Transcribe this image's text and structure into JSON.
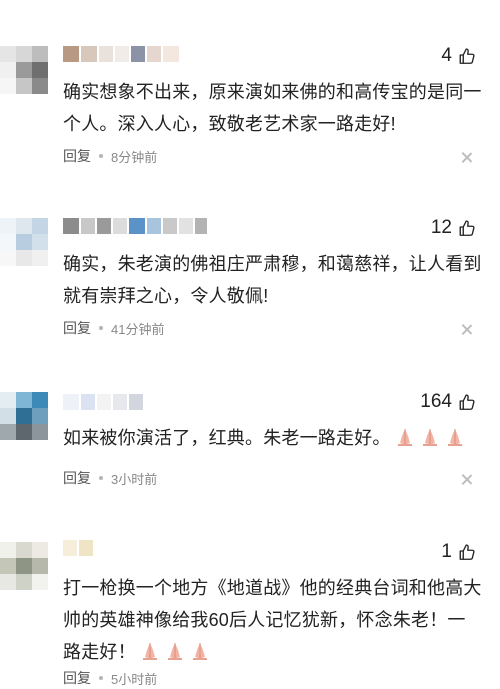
{
  "comments": [
    {
      "likes": "4",
      "text": "确实想象不出来，原来演如来佛的和高传宝的是同一个人。深入人心，致敬老艺术家一路走好!",
      "reply_label": "回复",
      "time": "8分钟前",
      "emoji_count": 0
    },
    {
      "likes": "12",
      "text": "确实，朱老演的佛祖庄严肃穆，和蔼慈祥，让人看到就有崇拜之心，令人敬佩!",
      "reply_label": "回复",
      "time": "41分钟前",
      "emoji_count": 0
    },
    {
      "likes": "164",
      "text": "如来被你演活了，红典。朱老一路走好。",
      "reply_label": "回复",
      "time": "3小时前",
      "emoji_count": 3
    },
    {
      "likes": "1",
      "text": "打一枪换一个地方《地道战》他的经典台词和他高大帅的英雄神像给我60后人记忆犹新，怀念朱老！一路走好！",
      "reply_label": "回复",
      "time": "5小时前",
      "emoji_count": 3
    }
  ],
  "icons": {
    "like": "thumbs-up-icon",
    "close": "close-icon",
    "emoji": "praying-hands-emoji"
  },
  "colors": {
    "text": "#222222",
    "meta": "#888888",
    "icon": "#bdbdbd",
    "emoji": "#f3b3a5"
  }
}
